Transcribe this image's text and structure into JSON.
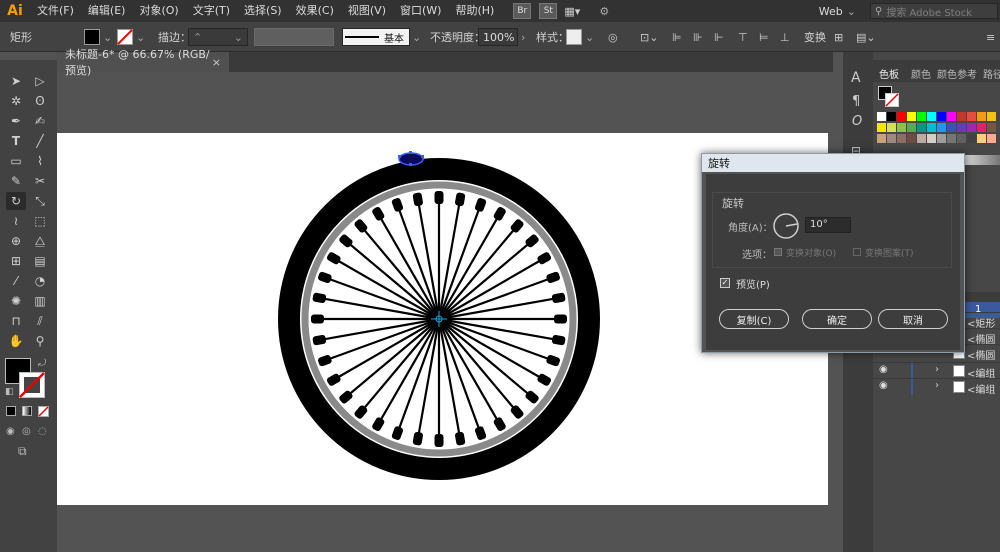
{
  "app": {
    "logo": "Ai"
  },
  "menus": [
    "文件(F)",
    "编辑(E)",
    "对象(O)",
    "文字(T)",
    "选择(S)",
    "效果(C)",
    "视图(V)",
    "窗口(W)",
    "帮助(H)"
  ],
  "menubar_right": {
    "bridge": "Br",
    "stock": "St",
    "workspace": "Web",
    "search_placeholder": "搜索 Adobe Stock"
  },
  "control": {
    "selection_type": "矩形",
    "stroke_label": "描边：",
    "stroke_style": "基本",
    "opacity_label": "不透明度：",
    "opacity_value": "100%",
    "style_label": "样式：",
    "transform_label": "变换"
  },
  "document_tab": {
    "title": "未标题-6* @ 66.67% (RGB/预览)",
    "close": "×"
  },
  "right_panel": {
    "tabs": [
      "色板",
      "颜色",
      "颜色参考",
      "路径"
    ]
  },
  "layers": {
    "layer_number": "1",
    "rows": [
      "<矩形",
      "<椭圆",
      "<椭圆",
      "<编组",
      "<编组"
    ]
  },
  "dialog": {
    "title": "旋转",
    "group_label": "旋转",
    "angle_label": "角度(A)：",
    "angle_value": "10°",
    "options_label": "选项：",
    "transform_objects": "变换对象(O)",
    "transform_patterns": "变换图案(T)",
    "preview_label": "预览(P)",
    "copy_button": "复制(C)",
    "ok_button": "确定",
    "cancel_button": "取消"
  },
  "colors": {
    "accent": "#ff9a00",
    "canvas": "#ffffff",
    "workspace": "#535353"
  }
}
